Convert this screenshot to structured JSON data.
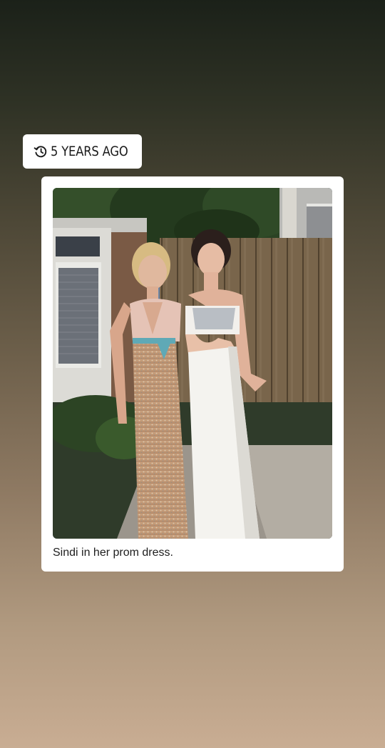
{
  "memory": {
    "badge_text": "5 YEARS AGO",
    "badge_icon": "history-icon",
    "caption": "Sindi in her prom dress."
  },
  "colors": {
    "card_bg": "#ffffff",
    "text": "#1e1e1e"
  }
}
